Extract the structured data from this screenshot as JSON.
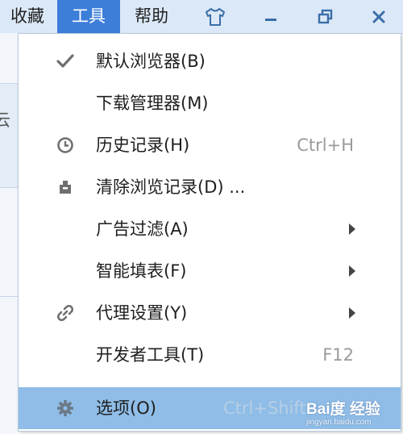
{
  "menubar": {
    "items": [
      {
        "label": "收藏",
        "active": false
      },
      {
        "label": "工具",
        "active": true
      },
      {
        "label": "帮助",
        "active": false
      }
    ],
    "icons": [
      "tshirt-skin-icon",
      "minimize-icon",
      "restore-icon",
      "close-icon"
    ]
  },
  "background": {
    "partial_char": "云"
  },
  "dropdown": {
    "items": [
      {
        "label": "默认浏览器(B)",
        "icon": "checkmark-icon",
        "shortcut": "",
        "submenu": false
      },
      {
        "label": "下载管理器(M)",
        "icon": "",
        "shortcut": "",
        "submenu": false
      },
      {
        "label": "历史记录(H)",
        "icon": "clock-icon",
        "shortcut": "Ctrl+H",
        "submenu": false
      },
      {
        "label": "清除浏览记录(D) ...",
        "icon": "eraser-icon",
        "shortcut": "",
        "submenu": false
      },
      {
        "label": "广告过滤(A)",
        "icon": "",
        "shortcut": "",
        "submenu": true
      },
      {
        "label": "智能填表(F)",
        "icon": "",
        "shortcut": "",
        "submenu": true
      },
      {
        "label": "代理设置(Y)",
        "icon": "link-icon",
        "shortcut": "",
        "submenu": true
      },
      {
        "label": "开发者工具(T)",
        "icon": "",
        "shortcut": "F12",
        "submenu": false
      },
      {
        "label": "选项(O)",
        "icon": "gear-icon",
        "shortcut": "Ctrl+Shift",
        "submenu": false,
        "highlighted": true
      }
    ]
  },
  "watermark": {
    "logo": "Bai度 经验",
    "url": "jingyan.baidu.com"
  },
  "colors": {
    "menubar_bg": "#dbe8f7",
    "active_menu": "#3d7ed8",
    "highlight_row": "#8fbde7"
  }
}
